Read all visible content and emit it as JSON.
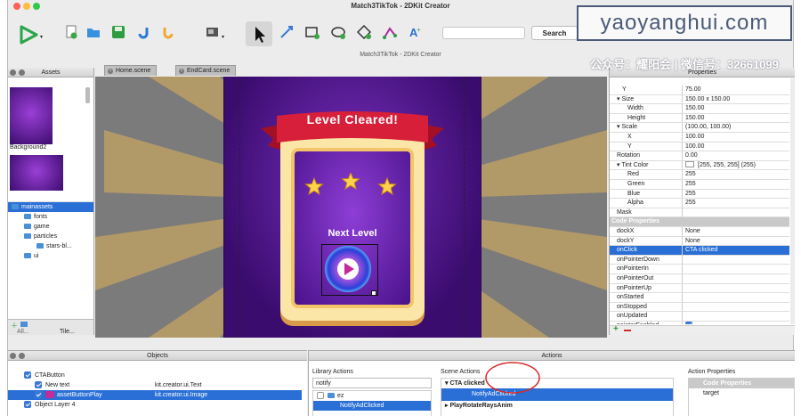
{
  "window": {
    "title": "Match3TikTok - 2DKit Creator",
    "subtitle": "Match3TikTok - 2DKit Creator"
  },
  "toolbar": {
    "search_label": "Search",
    "search_value": ""
  },
  "watermark": {
    "site": "yaoyanghui.com",
    "wechat": "公众号：耀阳会 | 微信号：32661099"
  },
  "tabs": [
    {
      "label": "Home.scene"
    },
    {
      "label": "EndCard.scene"
    }
  ],
  "assets": {
    "title": "Assets",
    "thumb_label": "Background2",
    "tree": [
      {
        "label": "mainassets",
        "level": 0,
        "selected": true
      },
      {
        "label": "fonts",
        "level": 1
      },
      {
        "label": "game",
        "level": 1
      },
      {
        "label": "particles",
        "level": 1
      },
      {
        "label": "stars-bl...",
        "level": 2
      },
      {
        "label": "ui",
        "level": 1
      }
    ],
    "bottom_tabs": [
      "All...",
      "Tile..."
    ]
  },
  "scene": {
    "level_title": "Level Cleared!",
    "next_label": "Next Level"
  },
  "properties": {
    "title": "Properties",
    "rows": [
      {
        "k": "Y",
        "v": "75.00",
        "indent": 2
      },
      {
        "k": "Size",
        "v": "150.00 x 150.00",
        "indent": 1,
        "toggle": true
      },
      {
        "k": "Width",
        "v": "150.00",
        "indent": 3
      },
      {
        "k": "Height",
        "v": "150.00",
        "indent": 3
      },
      {
        "k": "Scale",
        "v": "(100.00, 100.00)",
        "indent": 1,
        "toggle": true
      },
      {
        "k": "X",
        "v": "100.00",
        "indent": 3
      },
      {
        "k": "Y",
        "v": "100.00",
        "indent": 3
      },
      {
        "k": "Rotation",
        "v": "0.00",
        "indent": 1
      },
      {
        "k": "Tint Color",
        "v": "[255, 255, 255] (255)",
        "indent": 1,
        "toggle": true,
        "swatch": true
      },
      {
        "k": "Red",
        "v": "255",
        "indent": 3
      },
      {
        "k": "Green",
        "v": "255",
        "indent": 3
      },
      {
        "k": "Blue",
        "v": "255",
        "indent": 3
      },
      {
        "k": "Alpha",
        "v": "255",
        "indent": 3
      },
      {
        "k": "Mask",
        "v": "",
        "indent": 1
      },
      {
        "k": "Code Properties",
        "v": "",
        "indent": 0,
        "section": true
      },
      {
        "k": "dockX",
        "v": "None",
        "indent": 1
      },
      {
        "k": "dockY",
        "v": "None",
        "indent": 1
      },
      {
        "k": "onClick",
        "v": "CTA clicked",
        "indent": 1,
        "selected": true
      },
      {
        "k": "onPointerDown",
        "v": "",
        "indent": 1
      },
      {
        "k": "onPointerIn",
        "v": "",
        "indent": 1
      },
      {
        "k": "onPointerOut",
        "v": "",
        "indent": 1
      },
      {
        "k": "onPointerUp",
        "v": "",
        "indent": 1
      },
      {
        "k": "onStarted",
        "v": "",
        "indent": 1
      },
      {
        "k": "onStopped",
        "v": "",
        "indent": 1
      },
      {
        "k": "onUpdated",
        "v": "",
        "indent": 1
      },
      {
        "k": "pointerEnabled",
        "v": "",
        "indent": 1,
        "checkbox": true
      }
    ]
  },
  "objects": {
    "title": "Objects",
    "rows": [
      {
        "name": "CTAButton",
        "type": "",
        "level": 0
      },
      {
        "name": "New text",
        "type": "kit.creator.ui.Text",
        "level": 1
      },
      {
        "name": "assetButtonPlay",
        "type": "kit.creator.ui.Image",
        "level": 1,
        "selected": true
      },
      {
        "name": "Object Layer 4",
        "type": "",
        "level": 0
      }
    ]
  },
  "actions": {
    "title": "Actions",
    "library_title": "Library Actions",
    "library_search": "notify",
    "library_rows": [
      {
        "label": "ez"
      },
      {
        "label": "NotifyAdClicked"
      }
    ],
    "scene_title": "Scene Actions",
    "scene_rows": [
      {
        "label": "CTA clicked",
        "bold": true
      },
      {
        "label": "NotifyAdClicked",
        "selected": true
      },
      {
        "label": "PlayRotateRaysAnim",
        "bold": true
      }
    ],
    "props_title": "Action Properties",
    "props_rows": [
      {
        "label": "Code Properties",
        "section": true
      },
      {
        "label": "target"
      }
    ]
  },
  "colors": {
    "accent": "#2a6fd6",
    "scene_bg": "#7d7d7d",
    "purple": "#4a1a8a",
    "ribbon": "#d81f3a"
  }
}
